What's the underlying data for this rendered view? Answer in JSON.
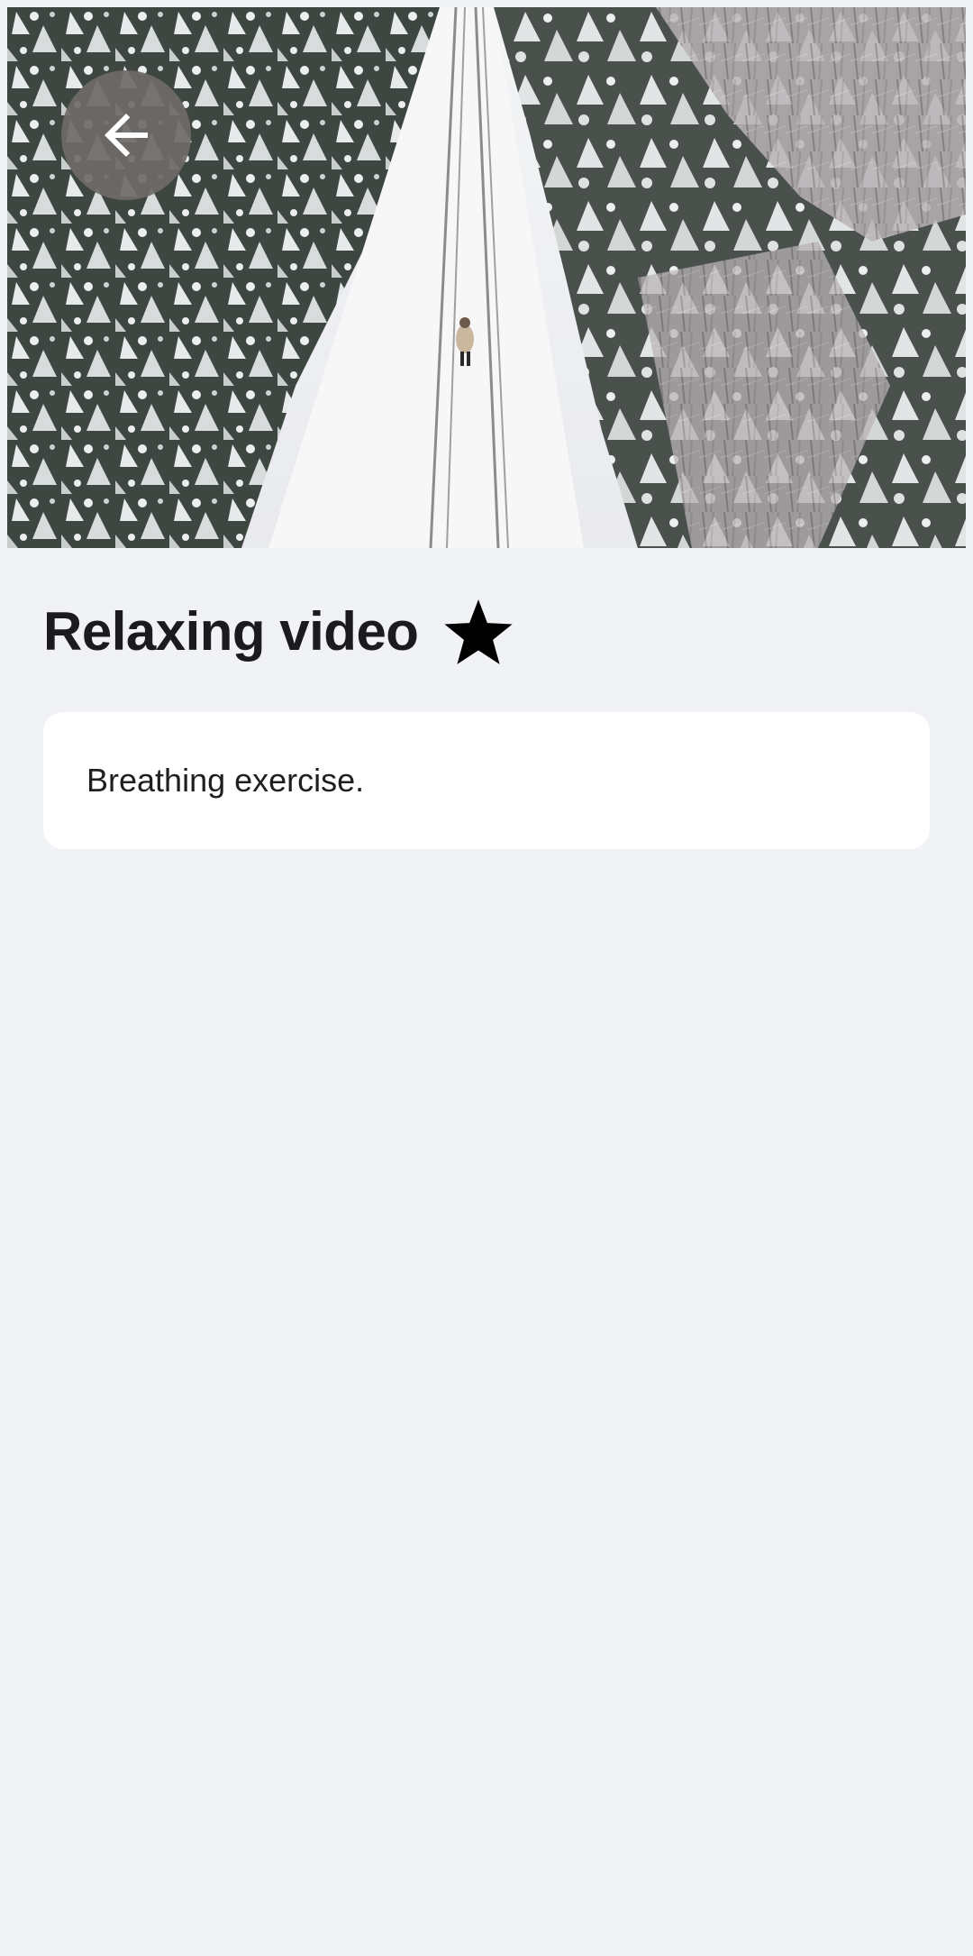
{
  "video": {
    "thumbnail_icon": "video-thumbnail",
    "back_icon": "arrow-left-icon"
  },
  "header": {
    "title": "Relaxing video",
    "favorite_icon": "star-icon",
    "favorited": true
  },
  "description": {
    "text": "Breathing exercise."
  },
  "colors": {
    "background": "#f1f2f6",
    "card": "#ffffff",
    "title": "#1b1b1f",
    "back_button": "#6e6a68"
  }
}
